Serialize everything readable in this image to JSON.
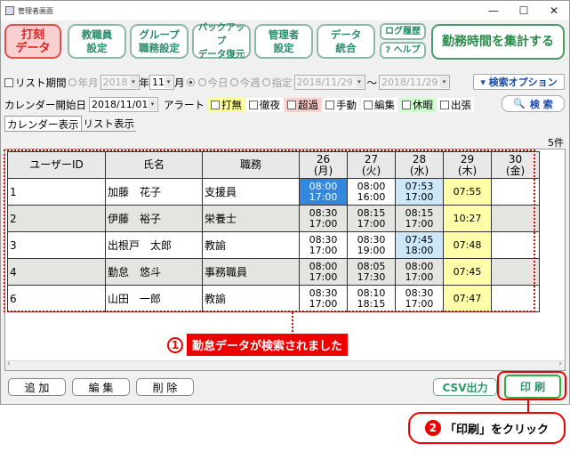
{
  "window": {
    "title": "管理者画面",
    "min": "—",
    "max": "☐",
    "close": "✕"
  },
  "toolbar": {
    "punch": "打刻\nデータ",
    "staff": "教職員\n設定",
    "group": "グループ\n職務設定",
    "backup": "バックアップ\nデータ復元",
    "admin": "管理者\n設定",
    "merge": "データ\n統合",
    "log": "ログ履歴",
    "help": "? ヘルプ",
    "tally": "勤務時間を集計する"
  },
  "filter": {
    "list_period": "リスト期間",
    "year_month": "年月",
    "year": "2018",
    "year_unit": "年",
    "month": "11",
    "month_unit": "月",
    "today": "今日",
    "this_week": "今週",
    "specified": "指定",
    "from": "2018/11/29",
    "tilde": "〜",
    "to": "2018/11/29",
    "search_option": "▾ 検索オプション"
  },
  "calendar": {
    "start_label": "カレンダー開始日",
    "start": "2018/11/01",
    "alert_label": "アラート",
    "alerts": [
      {
        "label": "打無",
        "color": "#ffff99"
      },
      {
        "label": "徹夜",
        "color": "#ffffff"
      },
      {
        "label": "超過",
        "color": "#ffcccc"
      },
      {
        "label": "手動",
        "color": "#ffffff"
      },
      {
        "label": "編集",
        "color": "#ffffff"
      },
      {
        "label": "休暇",
        "color": "#ccffcc"
      },
      {
        "label": "出張",
        "color": "#ffffff"
      }
    ],
    "search": "検 索"
  },
  "tabs": {
    "calendar_view": "カレンダー表示",
    "list_view": "リスト表示"
  },
  "count": "5件",
  "table": {
    "headers": {
      "user_id": "ユーザーID",
      "name": "氏名",
      "job": "職務"
    },
    "days": [
      {
        "d": "26",
        "w": "(月)"
      },
      {
        "d": "27",
        "w": "(火)"
      },
      {
        "d": "28",
        "w": "(水)"
      },
      {
        "d": "29",
        "w": "(木)"
      },
      {
        "d": "30",
        "w": "(金)"
      }
    ],
    "rows": [
      {
        "id": "1",
        "name": "加藤　花子",
        "job": "支援員",
        "cells": [
          {
            "in": "08:00",
            "out": "17:00",
            "c": "#3388dd",
            "t": "#fff"
          },
          {
            "in": "08:00",
            "out": "16:00",
            "c": "#fff"
          },
          {
            "in": "07:53",
            "out": "17:00",
            "c": "#cce8f8"
          },
          {
            "in": "07:55",
            "out": "",
            "c": "#ffffaa"
          },
          {
            "in": "",
            "out": "",
            "c": "#fff"
          }
        ]
      },
      {
        "id": "2",
        "name": "伊藤　裕子",
        "job": "栄養士",
        "cells": [
          {
            "in": "08:30",
            "out": "17:00",
            "c": ""
          },
          {
            "in": "08:15",
            "out": "17:00",
            "c": ""
          },
          {
            "in": "08:15",
            "out": "17:00",
            "c": ""
          },
          {
            "in": "10:27",
            "out": "",
            "c": "#ffffaa"
          },
          {
            "in": "",
            "out": "",
            "c": ""
          }
        ]
      },
      {
        "id": "3",
        "name": "出根戸　太郎",
        "job": "教諭",
        "cells": [
          {
            "in": "08:30",
            "out": "17:00",
            "c": "#fff"
          },
          {
            "in": "08:30",
            "out": "19:00",
            "c": "#fff"
          },
          {
            "in": "07:45",
            "out": "18:00",
            "c": "#cce8f8"
          },
          {
            "in": "07:48",
            "out": "",
            "c": "#ffffaa"
          },
          {
            "in": "",
            "out": "",
            "c": "#fff"
          }
        ]
      },
      {
        "id": "4",
        "name": "勤怠　悠斗",
        "job": "事務職員",
        "cells": [
          {
            "in": "08:00",
            "out": "17:00",
            "c": ""
          },
          {
            "in": "08:05",
            "out": "17:30",
            "c": ""
          },
          {
            "in": "08:00",
            "out": "17:00",
            "c": ""
          },
          {
            "in": "07:45",
            "out": "",
            "c": "#ffffaa"
          },
          {
            "in": "",
            "out": "",
            "c": ""
          }
        ]
      },
      {
        "id": "6",
        "name": "山田　一郎",
        "job": "教諭",
        "cells": [
          {
            "in": "08:30",
            "out": "17:00",
            "c": "#fff"
          },
          {
            "in": "08:10",
            "out": "18:15",
            "c": "#fff"
          },
          {
            "in": "08:30",
            "out": "17:00",
            "c": "#fff"
          },
          {
            "in": "07:47",
            "out": "",
            "c": "#ffffaa"
          },
          {
            "in": "",
            "out": "",
            "c": "#fff"
          }
        ]
      }
    ]
  },
  "bottom": {
    "add": "追 加",
    "edit": "編 集",
    "delete": "削 除",
    "csv": "CSV出力",
    "print": "印 刷"
  },
  "annotations": {
    "n1": "1",
    "t1": "勤怠データが検索されました",
    "n2": "2",
    "t2": "「印刷」をクリック"
  }
}
